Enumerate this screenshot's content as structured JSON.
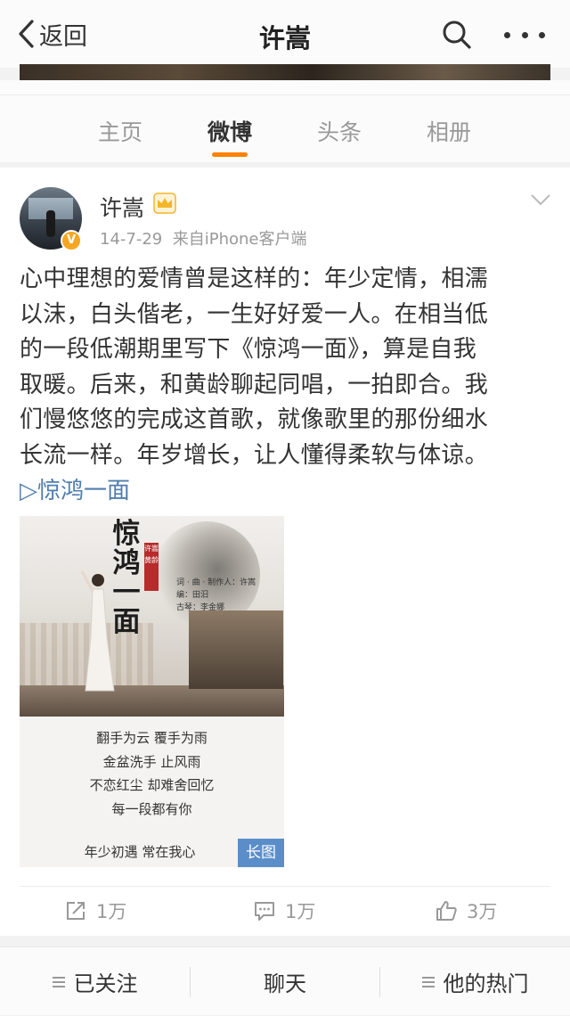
{
  "nav": {
    "back_label": "返回",
    "title": "许嵩"
  },
  "tabs": [
    {
      "label": "主页",
      "active": false
    },
    {
      "label": "微博",
      "active": true
    },
    {
      "label": "头条",
      "active": false
    },
    {
      "label": "相册",
      "active": false
    }
  ],
  "post": {
    "username": "许嵩",
    "date": "14-7-29",
    "source": "来自iPhone客户端",
    "verified_badge": "V",
    "text_lines": [
      "心中理想的爱情曾是这样的：年少定情，相濡",
      "以沫，白头偕老，一生好好爱一人。在相当低",
      "的一段低潮期里写下《惊鸿一面》，算是自我",
      "取暖。后来，和黄龄聊起同唱，一拍即合。我",
      "们慢悠悠的完成这首歌，就像歌里的那份细水",
      "长流一样。年岁增长，让人懂得柔软与体谅。"
    ],
    "link": "▷惊鸿一面",
    "poster": {
      "title": "惊鸿一面",
      "seal": "许嵩黄龄",
      "credits": [
        "词 · 曲 · 制作人：许嵩",
        "编：田汨",
        "古琴：李金娜"
      ],
      "lyrics": [
        "翻手为云  覆手为雨",
        "金盆洗手  止风雨",
        "不恋红尘  却难舍回忆",
        "每一段都有你"
      ],
      "lyric_last": "年少初遇  常在我心",
      "long_image_label": "长图"
    },
    "actions": {
      "repost": "1万",
      "comment": "1万",
      "like": "3万"
    }
  },
  "bottom": {
    "follow": "已关注",
    "chat": "聊天",
    "hot": "他的热门"
  },
  "colors": {
    "accent": "#ff8200",
    "link": "#507daf",
    "long_image_badge": "#5b8ec9"
  }
}
